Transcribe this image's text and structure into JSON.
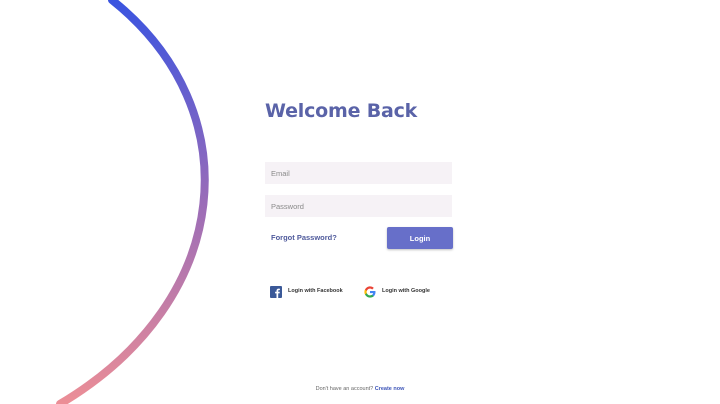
{
  "title": "Welcome Back",
  "form": {
    "email_placeholder": "Email",
    "password_placeholder": "Password",
    "forgot_label": "Forgot Password?",
    "login_label": "Login"
  },
  "social": {
    "facebook_label": "Login with Facebook",
    "google_label": "Login with Google"
  },
  "footer": {
    "text": "Don't have an account?",
    "link": "Create now"
  },
  "colors": {
    "accent": "#676fc9",
    "title": "#5a63a8",
    "arc_top": "#3a54e0",
    "arc_mid": "#8a6ab8",
    "arc_bottom": "#e88a98",
    "field_bg": "#f6f2f6"
  },
  "icons": [
    "facebook-icon",
    "google-icon"
  ]
}
